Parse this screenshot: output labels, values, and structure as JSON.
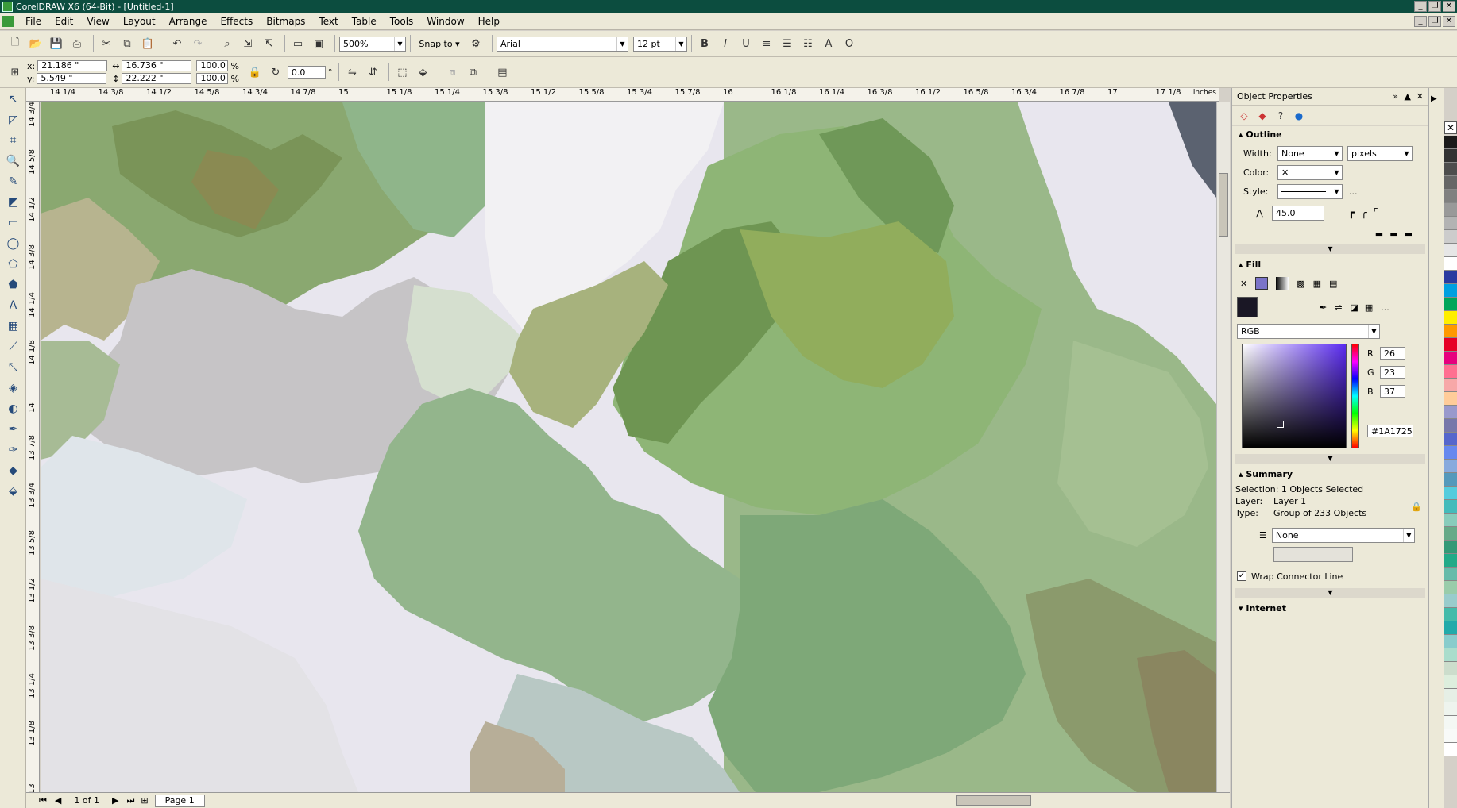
{
  "window": {
    "title": "CorelDRAW X6 (64-Bit) - [Untitled-1]"
  },
  "menu": [
    "File",
    "Edit",
    "View",
    "Layout",
    "Arrange",
    "Effects",
    "Bitmaps",
    "Text",
    "Table",
    "Tools",
    "Window",
    "Help"
  ],
  "toolbar": {
    "zoom": "500%",
    "snap_to": "Snap to",
    "font": "Arial",
    "font_size": "12 pt"
  },
  "propbar": {
    "x_label": "x:",
    "x": "21.186 \"",
    "y_label": "y:",
    "y": "5.549 \"",
    "w": "16.736 \"",
    "h": "22.222 \"",
    "scale_w": "100.0",
    "scale_h": "100.0",
    "percent": "%",
    "rotation": "0.0",
    "degree": "°"
  },
  "ruler": {
    "unit": "inches",
    "h_ticks": [
      "14 1/4",
      "14 3/8",
      "14 1/2",
      "14 5/8",
      "14 3/4",
      "14 7/8",
      "15",
      "15 1/8",
      "15 1/4",
      "15 3/8",
      "15 1/2",
      "15 5/8",
      "15 3/4",
      "15 7/8",
      "16",
      "16 1/8",
      "16 1/4",
      "16 3/8",
      "16 1/2",
      "16 5/8",
      "16 3/4",
      "16 7/8",
      "17",
      "17 1/8"
    ],
    "v_ticks": [
      "14 3/4",
      "14 5/8",
      "14 1/2",
      "14 3/8",
      "14 1/4",
      "14 1/8",
      "14",
      "13 7/8",
      "13 3/4",
      "13 5/8",
      "13 1/2",
      "13 3/8",
      "13 1/4",
      "13 1/8",
      "13"
    ]
  },
  "page_nav": {
    "page_count": "1 of 1",
    "page_tab": "Page 1"
  },
  "docker": {
    "title": "Object Properties",
    "outline": {
      "heading": "Outline",
      "width_label": "Width:",
      "width": "None",
      "unit": "pixels",
      "color_label": "Color:",
      "style_label": "Style:",
      "more": "...",
      "miter": "45.0"
    },
    "fill": {
      "heading": "Fill",
      "model": "RGB",
      "r_label": "R",
      "r": "26",
      "g_label": "G",
      "g": "23",
      "b_label": "B",
      "b": "37",
      "hex": "#1A1725",
      "more": "..."
    },
    "summary": {
      "heading": "Summary",
      "selection": "Selection: 1 Objects Selected",
      "layer_label": "Layer:",
      "layer": "Layer 1",
      "type_label": "Type:",
      "type": "Group of 233 Objects",
      "style": "None"
    },
    "wrap": {
      "label": "Wrap Connector Line",
      "checked": true
    },
    "internet": {
      "heading": "Internet"
    }
  },
  "palette": [
    "#1a1a1a",
    "#333333",
    "#4d4d4d",
    "#666666",
    "#808080",
    "#999999",
    "#b3b3b3",
    "#cccccc",
    "#e6e6e6",
    "#ffffff",
    "#2a3aa0",
    "#00a0e0",
    "#00a65a",
    "#ffee00",
    "#ff9900",
    "#e60026",
    "#e6007e",
    "#ff6f91",
    "#f7a8a8",
    "#ffcc99",
    "#9999cc",
    "#7777aa",
    "#5566cc",
    "#6688ee",
    "#88aadd",
    "#5599bb",
    "#55ccdd",
    "#44bbbb",
    "#88ccbb",
    "#66aa88",
    "#339977",
    "#22aa88",
    "#66bbaa",
    "#99ccaa",
    "#99cccc",
    "#44bbaa",
    "#22aaaa",
    "#88cccc",
    "#aaddcc",
    "#ccddcc",
    "#ddeedd",
    "#e6efe6",
    "#eef4ee",
    "#f4f8f4",
    "#f8faf8",
    "#ffffff"
  ],
  "colors": {
    "title_bar": "#0c4d3f",
    "chrome": "#ece9d8",
    "selection_fill": "#1A1725"
  }
}
